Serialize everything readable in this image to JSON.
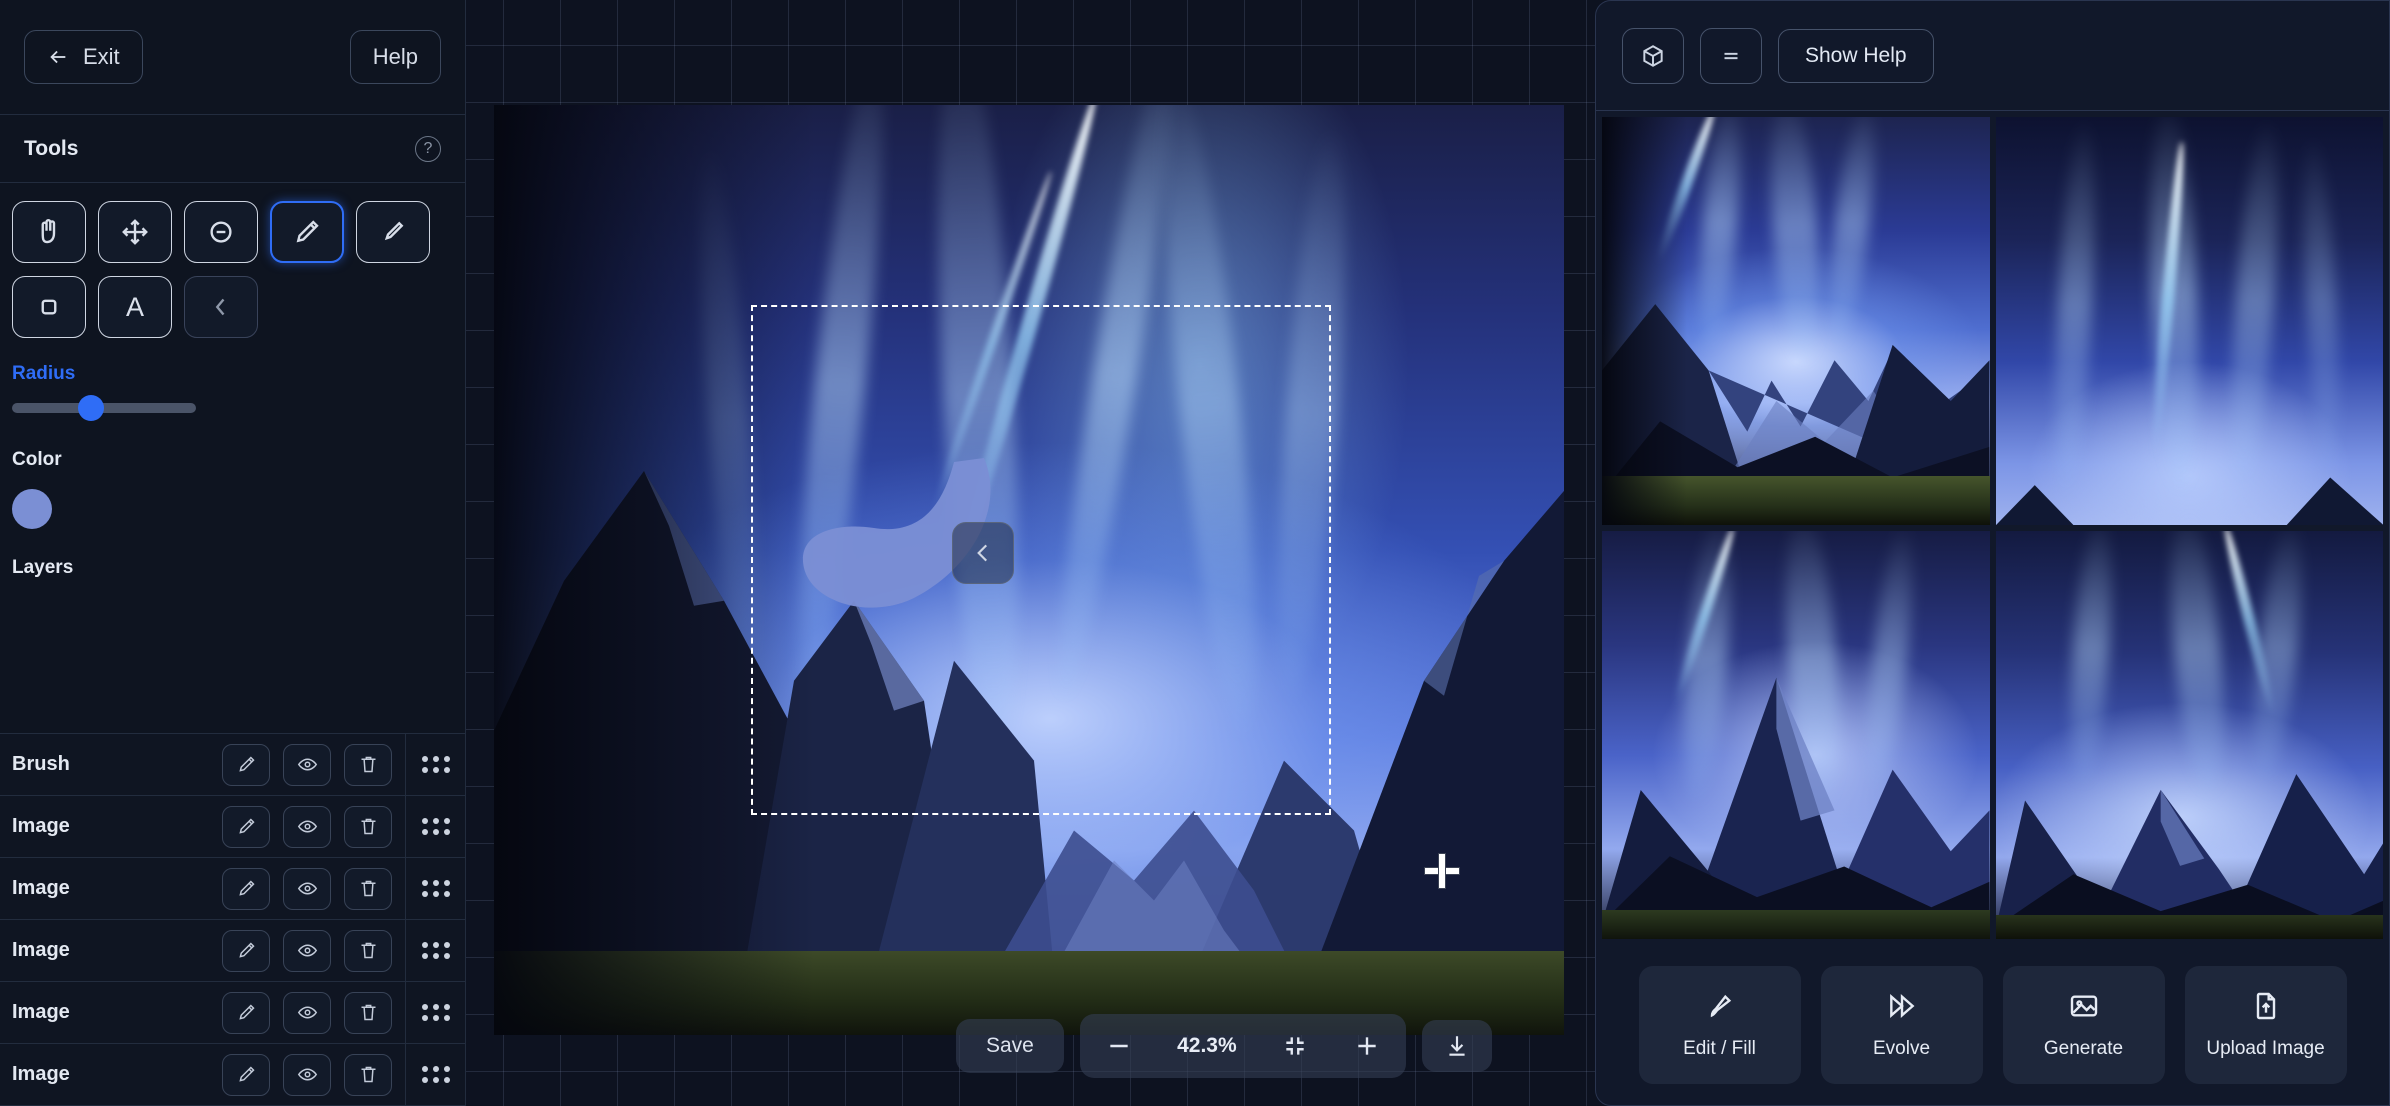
{
  "sidebar": {
    "exit_label": "Exit",
    "help_label": "Help",
    "tools_title": "Tools",
    "tools_help_icon": "question-circle-icon",
    "tools": [
      {
        "name": "hand-tool",
        "icon": "hand-icon",
        "active": false
      },
      {
        "name": "move-tool",
        "icon": "move-arrows-icon",
        "active": false
      },
      {
        "name": "eraser-tool",
        "icon": "circle-minus-icon",
        "active": false
      },
      {
        "name": "pencil-tool",
        "icon": "pencil-icon",
        "active": true
      },
      {
        "name": "eyedropper-tool",
        "icon": "eyedropper-icon",
        "active": false
      },
      {
        "name": "shape-tool",
        "icon": "square-icon",
        "active": false
      },
      {
        "name": "text-tool",
        "icon": "letter-a-icon",
        "active": false
      },
      {
        "name": "collapse-tool",
        "icon": "chevron-left-icon",
        "active": false
      }
    ],
    "radius_label": "Radius",
    "radius_accent_color": "#2f6df6",
    "color_label": "Color",
    "color_swatch": "#7b8fd4",
    "layers_label": "Layers",
    "layer_rows": [
      {
        "name": "Brush"
      },
      {
        "name": "Image"
      },
      {
        "name": "Image"
      },
      {
        "name": "Image"
      },
      {
        "name": "Image"
      },
      {
        "name": "Image"
      }
    ],
    "layer_actions": [
      {
        "name": "edit-layer-button",
        "icon": "pencil-icon"
      },
      {
        "name": "toggle-visibility-button",
        "icon": "eye-icon"
      },
      {
        "name": "delete-layer-button",
        "icon": "trash-icon"
      }
    ],
    "layer_handle_icon": "drag-handle-icon"
  },
  "canvas": {
    "prev_icon": "chevron-left-icon",
    "next_icon": "chevron-right-icon",
    "cursor_icon": "crosshair-cursor",
    "selection_label": "selection-marquee"
  },
  "bottom_toolbar": {
    "save_label": "Save",
    "zoom_out_icon": "minus-icon",
    "zoom_value": "42.3%",
    "fit_icon": "fit-to-screen-icon",
    "zoom_in_icon": "plus-icon",
    "download_icon": "download-icon"
  },
  "right_panel": {
    "cube_icon": "cube-icon",
    "menu_icon": "equals-menu-icon",
    "show_help_label": "Show Help",
    "thumbnails": [
      {
        "name": "thumbnail-1"
      },
      {
        "name": "thumbnail-2"
      },
      {
        "name": "thumbnail-3"
      },
      {
        "name": "thumbnail-4"
      }
    ],
    "actions": [
      {
        "label": "Edit / Fill",
        "icon": "brush-icon",
        "name": "edit-fill-button"
      },
      {
        "label": "Evolve",
        "icon": "fast-forward-icon",
        "name": "evolve-button"
      },
      {
        "label": "Generate",
        "icon": "image-icon",
        "name": "generate-button"
      },
      {
        "label": "Upload Image",
        "icon": "file-upload-icon",
        "name": "upload-image-button"
      }
    ]
  }
}
